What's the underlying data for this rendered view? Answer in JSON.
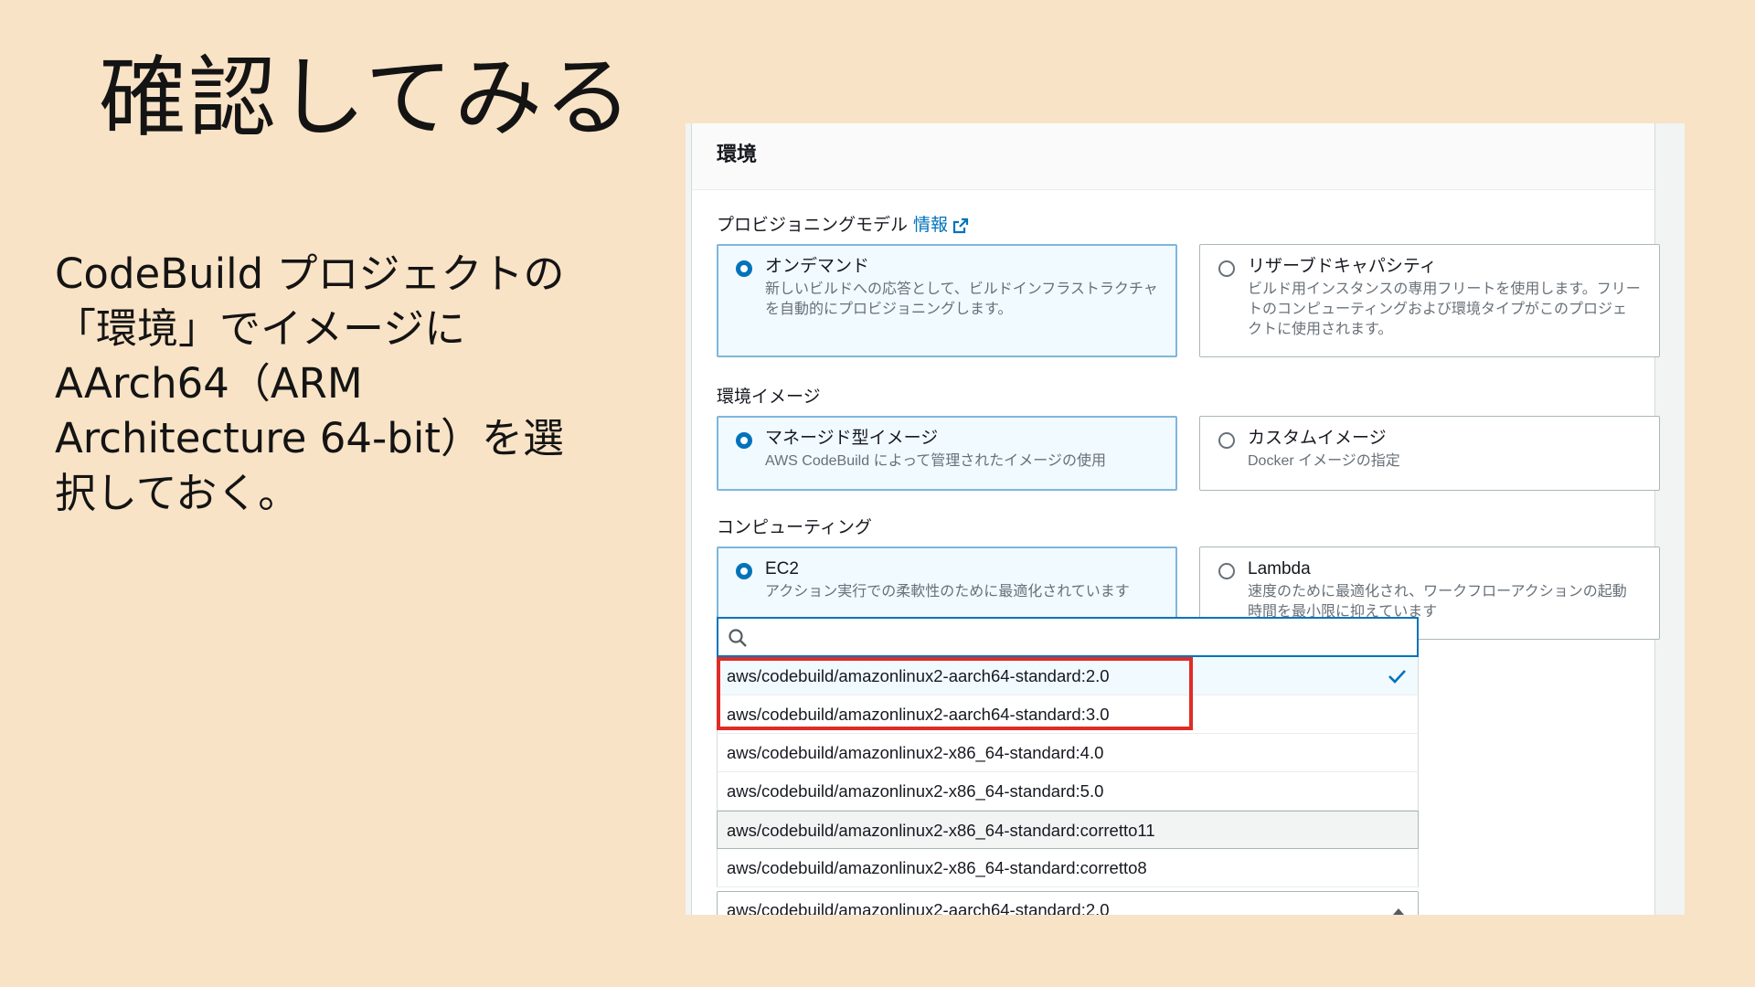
{
  "slide": {
    "title": "確認してみる",
    "body": " CodeBuild プロジェクトの\n「環境」でイメージに\nAArch64（ARM\nArchitecture 64-bit）を選\n択しておく。"
  },
  "panel": {
    "header": "環境",
    "provisioning": {
      "label": "プロビジョニングモデル",
      "info_link": "情報",
      "options": [
        {
          "title": "オンデマンド",
          "desc": "新しいビルドへの応答として、ビルドインフラストラクチャを自動的にプロビジョニングします。",
          "selected": true
        },
        {
          "title": "リザーブドキャパシティ",
          "desc": "ビルド用インスタンスの専用フリートを使用します。フリートのコンピューティングおよび環境タイプがこのプロジェクトに使用されます。",
          "selected": false
        }
      ]
    },
    "environment_image": {
      "label": "環境イメージ",
      "options": [
        {
          "title": "マネージド型イメージ",
          "desc": "AWS CodeBuild によって管理されたイメージの使用",
          "selected": true
        },
        {
          "title": "カスタムイメージ",
          "desc": "Docker イメージの指定",
          "selected": false
        }
      ]
    },
    "compute": {
      "label": "コンピューティング",
      "options": [
        {
          "title": "EC2",
          "desc": "アクション実行での柔軟性のために最適化されています",
          "selected": true
        },
        {
          "title": "Lambda",
          "desc": "速度のために最適化され、ワークフローアクションの起動時間を最小限に抑えています",
          "selected": false
        }
      ]
    },
    "image_dropdown": {
      "search_placeholder": "",
      "options": [
        "aws/codebuild/amazonlinux2-aarch64-standard:2.0",
        "aws/codebuild/amazonlinux2-aarch64-standard:3.0",
        "aws/codebuild/amazonlinux2-x86_64-standard:4.0",
        "aws/codebuild/amazonlinux2-x86_64-standard:5.0",
        "aws/codebuild/amazonlinux2-x86_64-standard:corretto11",
        "aws/codebuild/amazonlinux2-x86_64-standard:corretto8"
      ],
      "selected_value": "aws/codebuild/amazonlinux2-aarch64-standard:2.0"
    }
  },
  "colors": {
    "background": "#f9e3c6",
    "accent": "#0073bb",
    "highlight": "#e02b27"
  }
}
